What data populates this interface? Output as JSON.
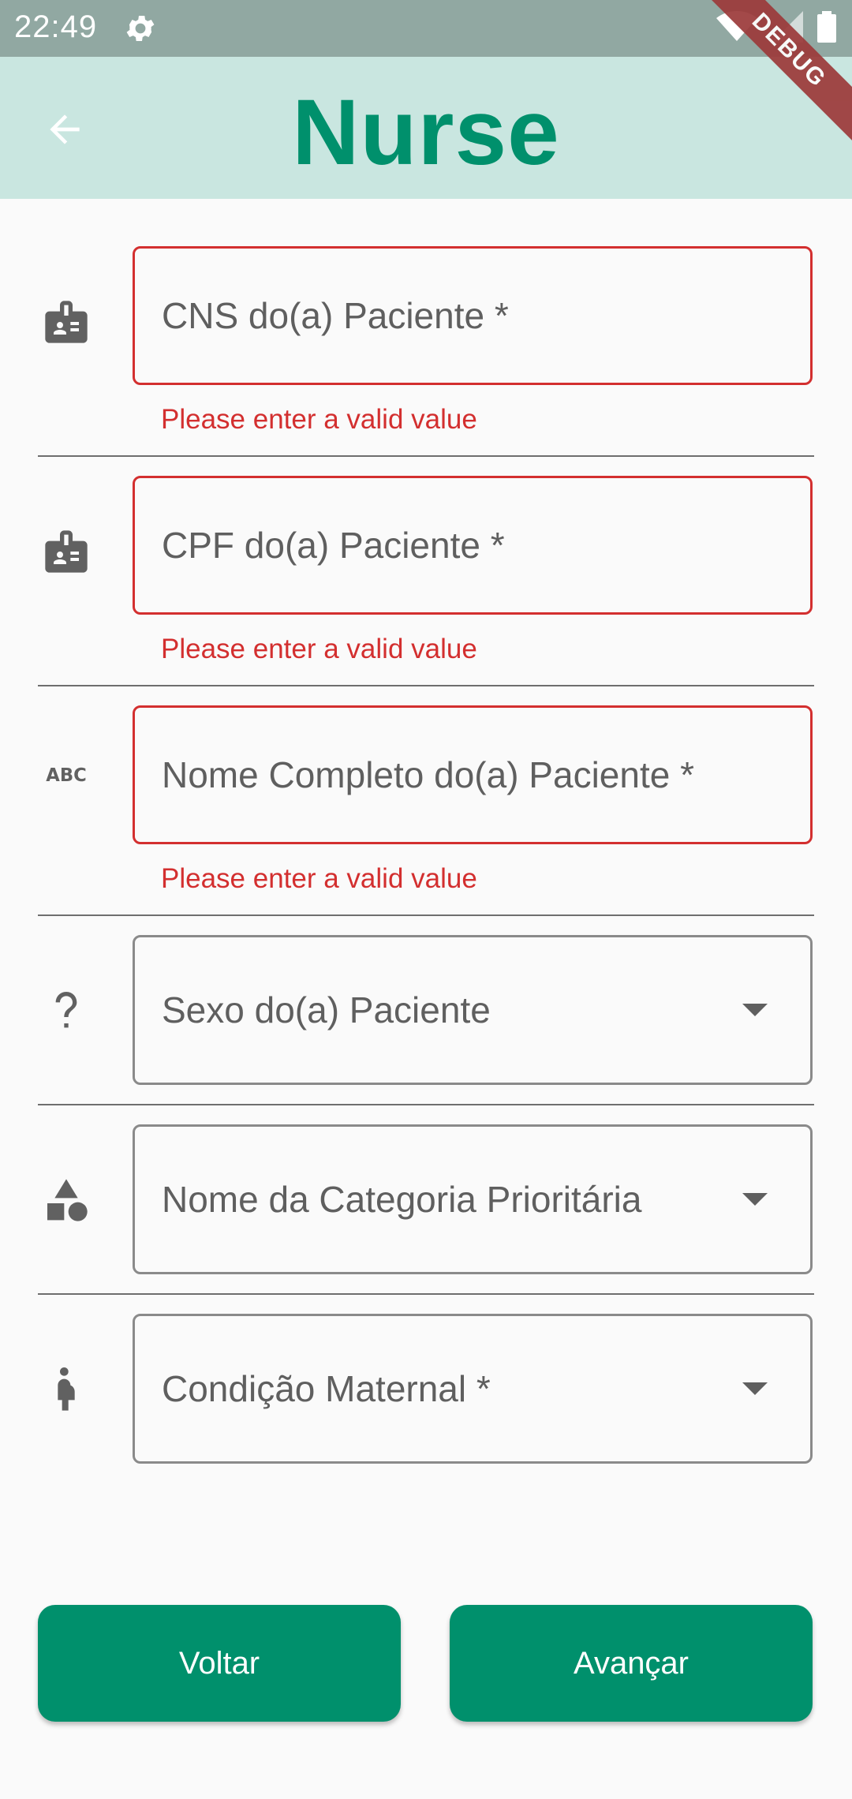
{
  "status_bar": {
    "time": "22:49"
  },
  "debug_banner": "DEBUG",
  "app_bar": {
    "title": "Nurse"
  },
  "form": {
    "fields": [
      {
        "label": "CNS do(a) Paciente *",
        "error": "Please enter a valid value",
        "icon": "badge-icon"
      },
      {
        "label": "CPF do(a) Paciente *",
        "error": "Please enter a valid value",
        "icon": "badge-icon"
      },
      {
        "label": "Nome Completo do(a) Paciente *",
        "error": "Please enter a valid value",
        "icon": "abc-icon"
      },
      {
        "label": "Sexo do(a) Paciente",
        "icon": "question-mark-icon"
      },
      {
        "label": "Nome da Categoria Prioritária",
        "icon": "category-icon"
      },
      {
        "label": "Condição Maternal *",
        "icon": "pregnant-woman-icon"
      }
    ]
  },
  "buttons": {
    "back": "Voltar",
    "next": "Avançar"
  },
  "colors": {
    "primary": "#00906c",
    "app_bar_bg": "#c9e6e0",
    "error": "#d32f2f",
    "status_bar_bg": "#91a8a2"
  }
}
